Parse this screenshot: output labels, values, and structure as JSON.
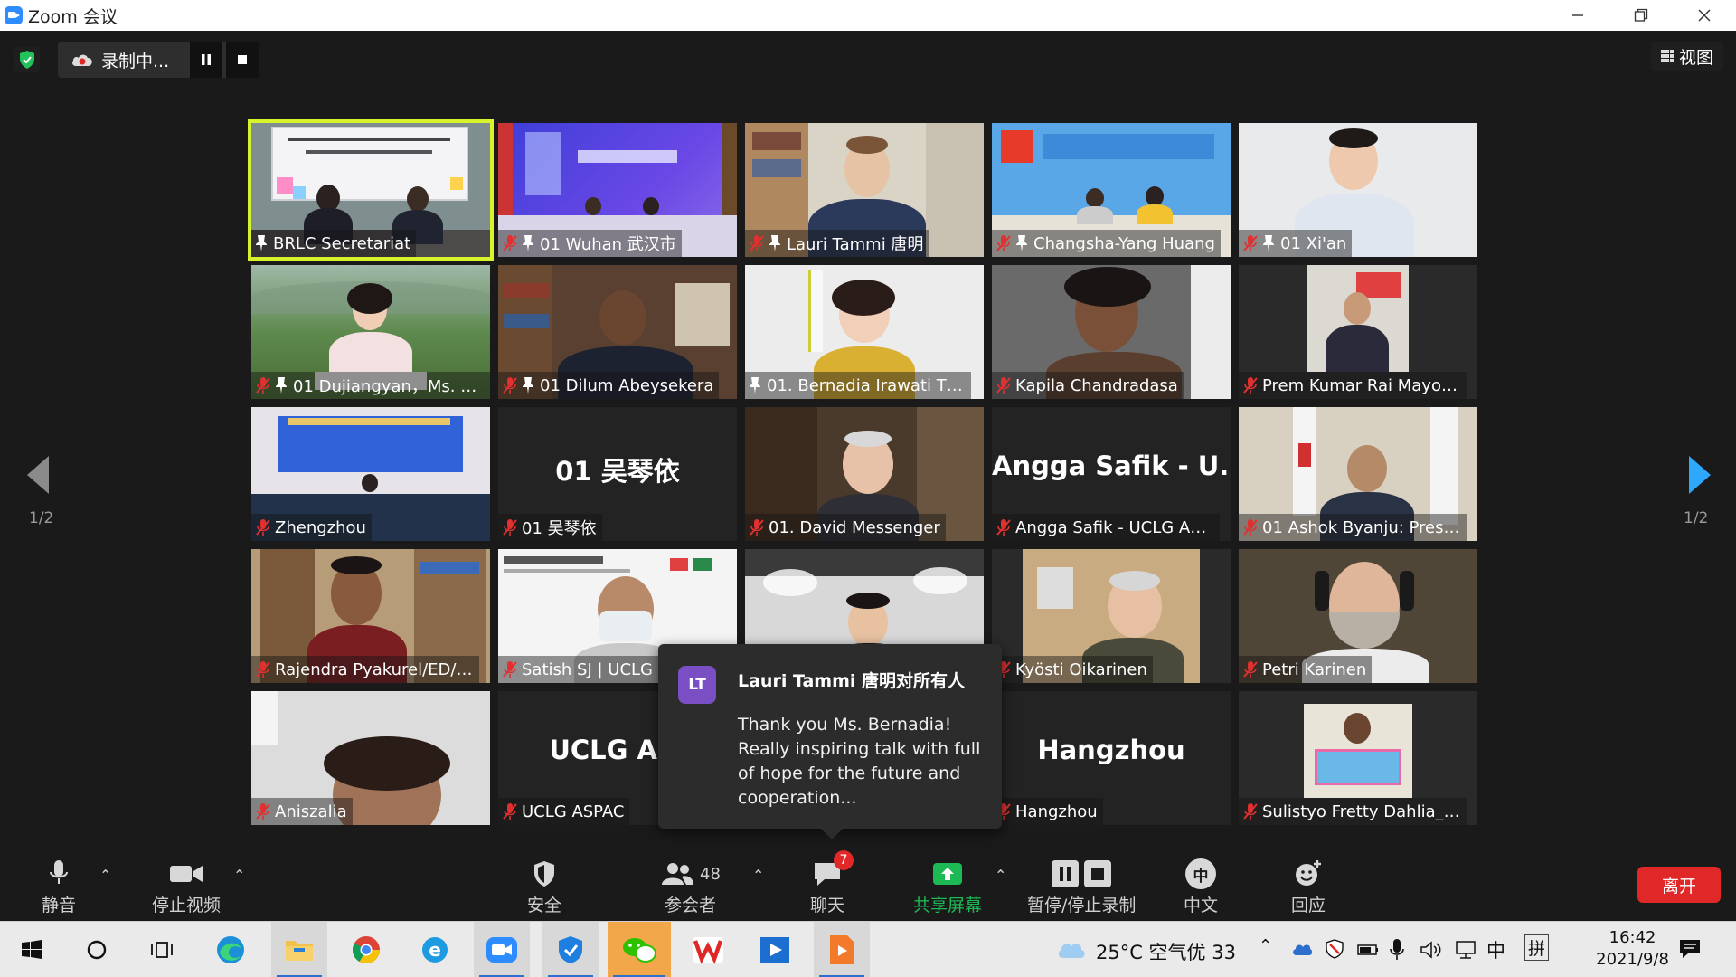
{
  "window": {
    "title": "Zoom 会议",
    "controls": [
      "minimize",
      "restore",
      "close"
    ]
  },
  "topbar": {
    "recording_label": "录制中...",
    "view_label": "视图"
  },
  "pagination": {
    "left": "1/2",
    "right": "1/2"
  },
  "tiles": [
    {
      "name": "BRLC Secretariat",
      "muted": false,
      "pinned": true,
      "active": true,
      "scene": "BRLC"
    },
    {
      "name": "01 Wuhan 武汉市",
      "muted": true,
      "pinned": true,
      "scene": "Wuhan"
    },
    {
      "name": "Lauri Tammi 唐明",
      "muted": true,
      "pinned": true,
      "scene": "Lauri"
    },
    {
      "name": "Changsha-Yang Huang",
      "muted": true,
      "pinned": true,
      "scene": "Changsha"
    },
    {
      "name": "01 Xi'an",
      "muted": true,
      "pinned": true,
      "scene": "Xian"
    },
    {
      "name": "01 Dujiangyan，Ms. Li...",
      "muted": true,
      "pinned": true,
      "scene": "Dujiangyan"
    },
    {
      "name": "01 Dilum Abeysekera",
      "muted": true,
      "pinned": true,
      "scene": "Dilum"
    },
    {
      "name": "01. Bernadia Irawati Tjan...",
      "muted": false,
      "pinned": true,
      "scene": "Bernadia"
    },
    {
      "name": "Kapila Chandradasa",
      "muted": true,
      "pinned": false,
      "scene": "Kapila"
    },
    {
      "name": "Prem Kumar Rai Mayor H...",
      "muted": true,
      "pinned": false,
      "scene": "Prem"
    },
    {
      "name": "Zhengzhou",
      "muted": true,
      "pinned": false,
      "scene": "Zhengzhou"
    },
    {
      "name": "01 吴琴依",
      "muted": true,
      "pinned": false,
      "scene": "text",
      "big_name": "01 吴琴依"
    },
    {
      "name": "01. David Messenger",
      "muted": true,
      "pinned": false,
      "scene": "David"
    },
    {
      "name": "Angga Safik - UCLG ASPAC",
      "muted": true,
      "pinned": false,
      "scene": "text",
      "big_name": "Angga Safik - U..."
    },
    {
      "name": "01 Ashok Byanju: Preside...",
      "muted": true,
      "pinned": false,
      "scene": "Ashok"
    },
    {
      "name": "Rajendra Pyakurel/ED/NA...",
      "muted": true,
      "pinned": false,
      "scene": "Rajendra"
    },
    {
      "name": "Satish SJ | UCLG",
      "muted": true,
      "pinned": false,
      "scene": "Satish"
    },
    {
      "name": "",
      "muted": false,
      "pinned": false,
      "scene": "Young"
    },
    {
      "name": "Kyösti Oikarinen",
      "muted": true,
      "pinned": false,
      "scene": "Kyosti"
    },
    {
      "name": "Petri Karinen",
      "muted": true,
      "pinned": false,
      "scene": "Petri"
    },
    {
      "name": "Aniszalia",
      "muted": true,
      "pinned": false,
      "scene": "Aniszalia"
    },
    {
      "name": "UCLG ASPAC",
      "muted": true,
      "pinned": false,
      "scene": "text",
      "big_name": "UCLG ASI"
    },
    {
      "name": "",
      "muted": false,
      "pinned": false,
      "scene": "blank"
    },
    {
      "name": "Hangzhou",
      "muted": true,
      "pinned": false,
      "scene": "text",
      "big_name": "Hangzhou"
    },
    {
      "name": "Sulistyo Fretty Dahlia_Ba...",
      "muted": true,
      "pinned": false,
      "scene": "Sulistyo"
    }
  ],
  "chat_popup": {
    "avatar": "LT",
    "sender": "Lauri Tammi 唐明对所有人",
    "message": "Thank you Ms. Bernadia! Really inspiring talk with full of hope for the future and cooperation..."
  },
  "toolbar": {
    "mute": "静音",
    "stop_video": "停止视频",
    "security": "安全",
    "participants": "参会者",
    "participants_count": "48",
    "chat": "聊天",
    "chat_badge": "7",
    "share": "共享屏幕",
    "pause_record": "暂停/停止录制",
    "interpretation": "中文",
    "interpretation_icon_text": "中",
    "reactions": "回应",
    "leave": "离开"
  },
  "taskbar": {
    "weather": "25°C 空气优 33",
    "ime1": "中",
    "ime2": "拼",
    "time": "16:42",
    "date": "2021/9/8"
  },
  "colors": {
    "active_speaker": "#d8f22b",
    "share_green": "#1db954",
    "leave_red": "#e02828",
    "muted_red": "#e03030",
    "arrow_blue": "#2ea8ff"
  }
}
